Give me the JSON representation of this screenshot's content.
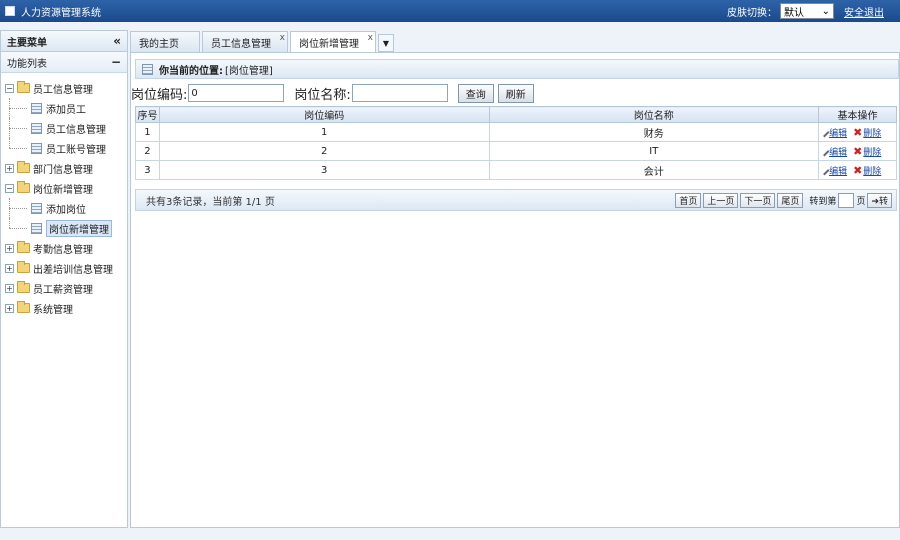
{
  "app": {
    "title": "人力资源管理系统",
    "skin_label": "皮肤切换：",
    "skin_value": "默认",
    "logout": "安全退出"
  },
  "sidebar": {
    "header": "主要菜单",
    "header_ctl": "«",
    "sub": "功能列表",
    "sub_ctl": "−",
    "tree": [
      {
        "label": "员工信息管理",
        "expanded": true,
        "pm": "−",
        "children": [
          "添加员工",
          "员工信息管理",
          "员工账号管理"
        ]
      },
      {
        "label": "部门信息管理",
        "expanded": false,
        "pm": "+"
      },
      {
        "label": "岗位新增管理",
        "expanded": true,
        "pm": "−",
        "children": [
          "添加岗位",
          "岗位新增管理"
        ]
      },
      {
        "label": "考勤信息管理",
        "expanded": false,
        "pm": "+"
      },
      {
        "label": "出差培训信息管理",
        "expanded": false,
        "pm": "+"
      },
      {
        "label": "员工薪资管理",
        "expanded": false,
        "pm": "+"
      },
      {
        "label": "系统管理",
        "expanded": false,
        "pm": "+"
      }
    ]
  },
  "tabs": [
    {
      "label": "我的主页",
      "closable": false
    },
    {
      "label": "员工信息管理",
      "closable": true
    },
    {
      "label": "岗位新增管理",
      "closable": true
    }
  ],
  "tab_close": "x",
  "tab_menu": "▼",
  "location": {
    "prefix": "你当前的位置:",
    "path": "[岗位管理]"
  },
  "search": {
    "code_label": "岗位编码:",
    "code_value": "0",
    "name_label": "岗位名称:",
    "name_value": "",
    "query": "查询",
    "refresh": "刷新"
  },
  "table": {
    "headers": [
      "序号",
      "岗位编码",
      "岗位名称",
      "基本操作"
    ],
    "rows": [
      {
        "no": "1",
        "code": "1",
        "name": "财务"
      },
      {
        "no": "2",
        "code": "2",
        "name": "IT"
      },
      {
        "no": "3",
        "code": "3",
        "name": "会计"
      }
    ],
    "edit": "编辑",
    "delete": "删除"
  },
  "pager": {
    "info": "共有3条记录，当前第 1/1 页",
    "first": "首页",
    "prev": "上一页",
    "next": "下一页",
    "last": "尾页",
    "goto_label": "转到第",
    "page_unit": "页",
    "go": "➔转"
  }
}
